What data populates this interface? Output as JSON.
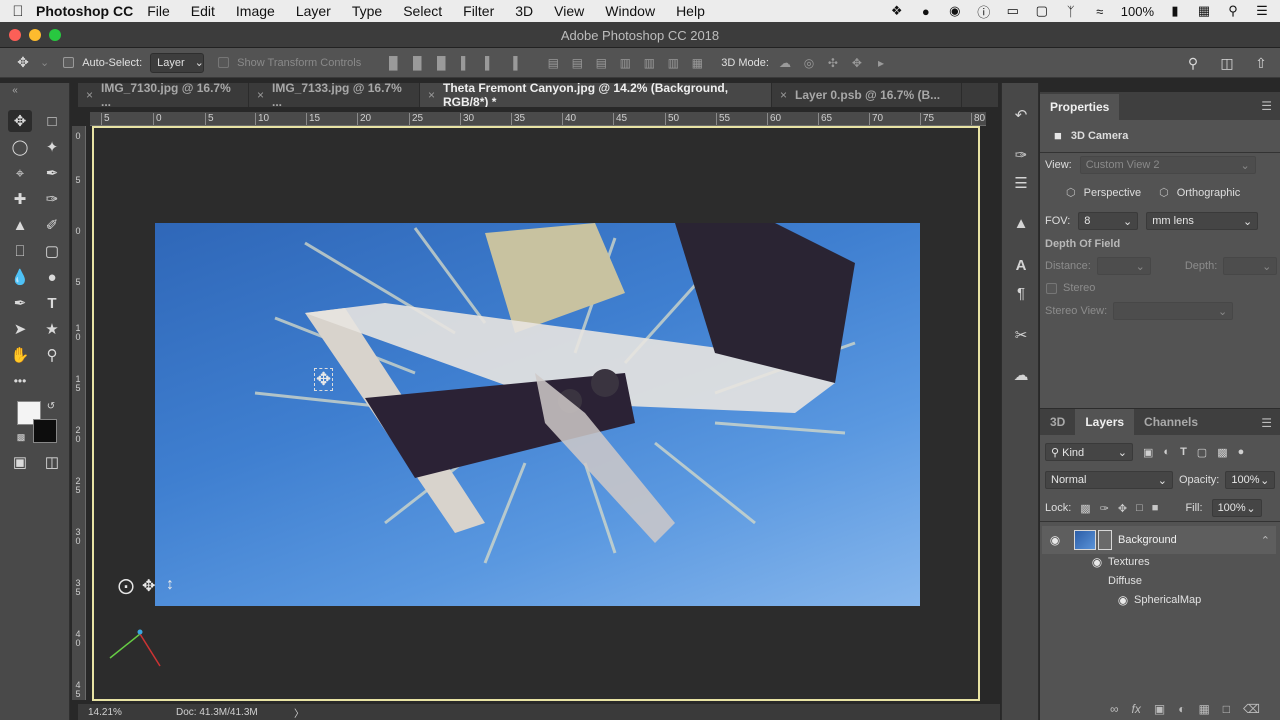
{
  "menubar": {
    "app_name": "Photoshop CC",
    "items": [
      "File",
      "Edit",
      "Image",
      "Layer",
      "Type",
      "Select",
      "Filter",
      "3D",
      "View",
      "Window",
      "Help"
    ],
    "battery": "100%"
  },
  "window": {
    "title": "Adobe Photoshop CC 2018"
  },
  "options_bar": {
    "auto_select_label": "Auto-Select:",
    "auto_select_value": "Layer",
    "transform_controls_label": "Show Transform Controls",
    "mode_3d_label": "3D Mode:"
  },
  "tabs": [
    {
      "label": "IMG_7130.jpg @ 16.7% ...",
      "active": false
    },
    {
      "label": "IMG_7133.jpg @ 16.7% ...",
      "active": false
    },
    {
      "label": "Theta Fremont Canyon.jpg @ 14.2% (Background, RGB/8*) *",
      "active": true
    },
    {
      "label": "Layer 0.psb @ 16.7% (B...",
      "active": false
    }
  ],
  "rulers": {
    "top": [
      "5",
      "0",
      "5",
      "10",
      "15",
      "20",
      "25",
      "30",
      "35",
      "40",
      "45",
      "50",
      "55",
      "60",
      "65",
      "70",
      "75",
      "80"
    ],
    "left": [
      "0",
      "5",
      "0",
      "5",
      "1 0",
      "1 5",
      "2 0",
      "2 5",
      "3 0",
      "3 5",
      "4 0",
      "4 5"
    ]
  },
  "statusbar": {
    "zoom": "14.21%",
    "doc": "Doc: 41.3M/41.3M",
    "arrow": "〉"
  },
  "properties": {
    "title": "Properties",
    "section": "3D Camera",
    "view_label": "View:",
    "view_value": "Custom View 2",
    "perspective_label": "Perspective",
    "orthographic_label": "Orthographic",
    "fov_label": "FOV:",
    "fov_value": "8",
    "lens_value": "mm lens",
    "dof_label": "Depth Of Field",
    "distance_label": "Distance:",
    "depth_label": "Depth:",
    "stereo_label": "Stereo",
    "stereo_view_label": "Stereo View:"
  },
  "layers_panel": {
    "tabs": [
      "3D",
      "Layers",
      "Channels"
    ],
    "kind_label": "Kind",
    "blend_mode": "Normal",
    "opacity_label": "Opacity:",
    "opacity_value": "100%",
    "lock_label": "Lock:",
    "fill_label": "Fill:",
    "fill_value": "100%",
    "layer_name": "Background",
    "textures_label": "Textures",
    "diffuse_label": "Diffuse",
    "spherical_label": "SphericalMap"
  },
  "colors": {
    "accent": "#e8e3a4",
    "panel": "#535353",
    "canvas_bg": "#2c2c2c",
    "sky_blue": "#3f7fd0"
  }
}
